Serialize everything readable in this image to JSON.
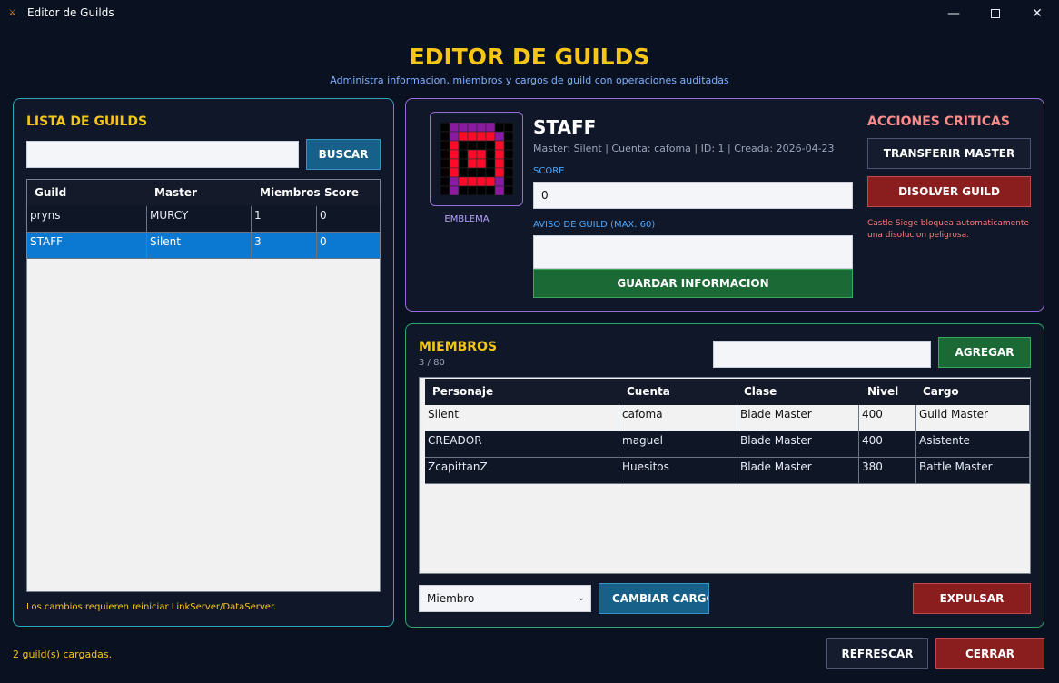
{
  "window": {
    "title": "Editor de Guilds",
    "minimize": "—",
    "close": "✕"
  },
  "header": {
    "title": "EDITOR DE GUILDS",
    "subtitle": "Administra informacion, miembros y cargos de guild con operaciones auditadas"
  },
  "guild_list": {
    "title": "LISTA DE GUILDS",
    "search_value": "",
    "search_button": "BUSCAR",
    "columns": [
      "Guild",
      "Master",
      "Miembros",
      "Score"
    ],
    "rows": [
      [
        "pryns",
        "MURCY",
        "1",
        "0"
      ],
      [
        "STAFF",
        "Silent",
        "3",
        "0"
      ]
    ],
    "selected_row": 1,
    "note": "Los cambios requieren reiniciar LinkServer/DataServer."
  },
  "info": {
    "emblem_label": "EMBLEMA",
    "guild_name": "STAFF",
    "meta": "Master: Silent | Cuenta: cafoma | ID: 1 | Creada: 2026-04-23",
    "score_label": "SCORE",
    "score_value": "0",
    "notice_label": "AVISO DE GUILD (MAX. 60)",
    "notice_value": "",
    "save_button": "GUARDAR INFORMACION"
  },
  "critical": {
    "title": "ACCIONES CRITICAS",
    "transfer_button": "TRANSFERIR MASTER",
    "dissolve_button": "DISOLVER GUILD",
    "note": "Castle Siege bloquea automaticamente una disolucion peligrosa."
  },
  "members": {
    "title": "MIEMBROS",
    "count": "3 / 80",
    "add_input_value": "",
    "add_button": "AGREGAR",
    "columns": [
      "Personaje",
      "Cuenta",
      "Clase",
      "Nivel",
      "Cargo"
    ],
    "rows": [
      [
        "Silent",
        "cafoma",
        "Blade Master",
        "400",
        "Guild Master"
      ],
      [
        "CREADOR",
        "maguel",
        "Blade Master",
        "400",
        "Asistente"
      ],
      [
        "ZcapittanZ",
        "Huesitos",
        "Blade Master",
        "380",
        "Battle Master"
      ]
    ],
    "role_select": "Miembro",
    "change_button": "CAMBIAR CARGO",
    "expel_button": "EXPULSAR"
  },
  "footer": {
    "status": "2 guild(s) cargadas.",
    "refresh_button": "REFRESCAR",
    "close_button": "CERRAR"
  },
  "colors": {
    "accent_yellow": "#f5c518",
    "emblem_red": "#ff0a2a",
    "emblem_purple": "#8a1aa0",
    "emblem_black": "#000000",
    "selection_blue": "#0b78d1"
  }
}
